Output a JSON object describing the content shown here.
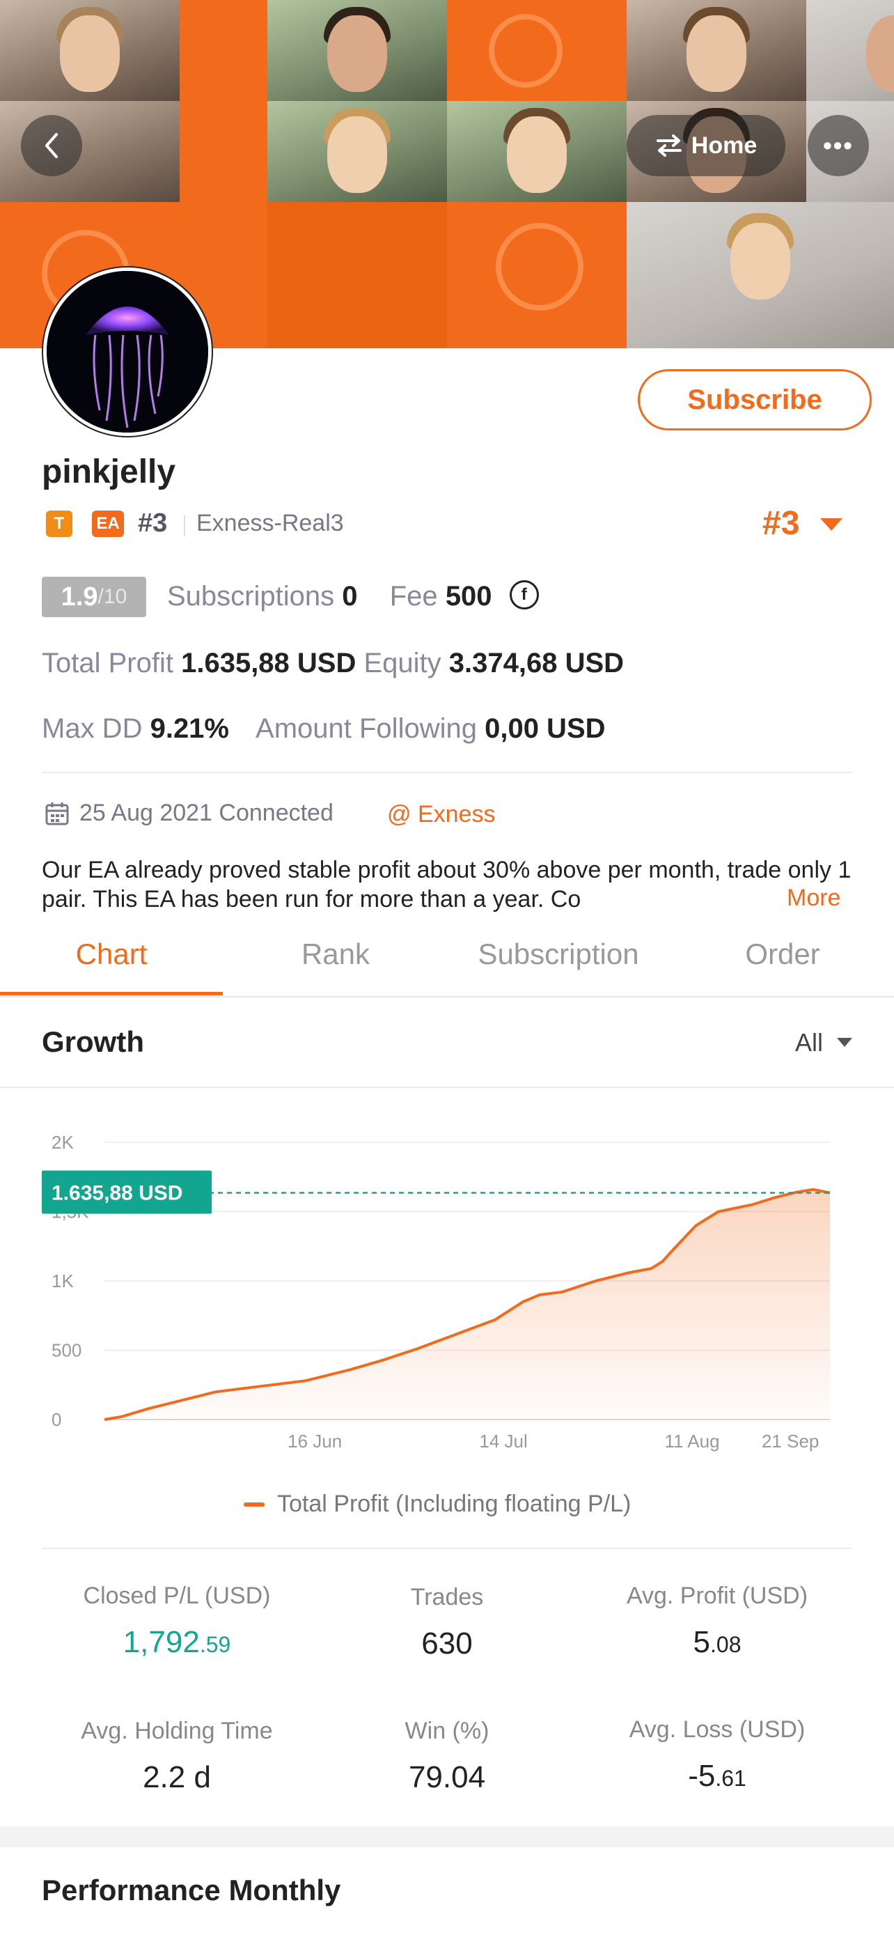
{
  "header": {
    "back_icon": "chevron-left-icon",
    "home_label": "Home",
    "home_icon": "swap-arrows-icon",
    "more_label": "•••"
  },
  "profile": {
    "username": "pinkjelly",
    "badge_t": "T",
    "badge_ea": "EA",
    "rank": "#3",
    "server": "Exness-Real3",
    "rank_big": "#3",
    "subscribe_label": "Subscribe",
    "score": "1.9",
    "score_den": "/10",
    "subscriptions_label": "Subscriptions",
    "subscriptions_value": "0",
    "fee_label": "Fee",
    "fee_value": "500",
    "fee_icon": "f",
    "total_profit_label": "Total Profit",
    "total_profit_value": "1.635,88 USD",
    "equity_label": "Equity",
    "equity_value": "3.374,68 USD",
    "max_dd_label": "Max DD",
    "max_dd_value": "9.21%",
    "amount_following_label": "Amount Following",
    "amount_following_value": "0,00 USD",
    "connected_text": "25 Aug 2021 Connected",
    "broker": "@ Exness",
    "description": "Our EA already proved stable profit about 30% above per month, trade only 1 pair. This EA has been run for more than a year. Co",
    "more_link": "More"
  },
  "tabs": [
    "Chart",
    "Rank",
    "Subscription",
    "Order"
  ],
  "growth": {
    "title": "Growth",
    "range": "All",
    "legend": "Total Profit (Including floating P/L)",
    "current_label": "1.635,88 USD"
  },
  "chart_data": {
    "type": "area",
    "series": [
      {
        "name": "Total Profit (Including floating P/L)",
        "x": [
          0,
          0.03,
          0.08,
          0.14,
          0.2,
          0.28,
          0.36,
          0.44,
          0.5,
          0.56,
          0.62,
          0.7,
          0.75,
          0.78,
          0.82,
          0.88,
          0.94,
          0.98,
          1.0,
          1.02,
          1.06,
          1.1,
          1.16,
          1.2,
          1.24,
          1.27,
          1.3
        ],
        "values": [
          0,
          20,
          80,
          140,
          200,
          240,
          280,
          360,
          430,
          510,
          600,
          720,
          850,
          900,
          920,
          1000,
          1060,
          1090,
          1140,
          1230,
          1400,
          1500,
          1550,
          1600,
          1640,
          1660,
          1635.88
        ]
      }
    ],
    "x_ticks": [
      "16 Jun",
      "14 Jul",
      "11 Aug",
      "21 Sep"
    ],
    "y_ticks": [
      "0",
      "500",
      "1K",
      "1,5K",
      "2K"
    ],
    "ylim": [
      0,
      2000
    ],
    "reference_value": 1635.88,
    "reference_label": "1.635,88 USD",
    "colors": {
      "line": "#f26b1d",
      "reference": "#12a690"
    }
  },
  "stats": [
    {
      "label": "Closed P/L (USD)",
      "int": "1,792",
      "dec": ".59",
      "green": true
    },
    {
      "label": "Trades",
      "int": "630",
      "dec": "",
      "green": false
    },
    {
      "label": "Avg. Profit (USD)",
      "int": "5",
      "dec": ".08",
      "green": false
    },
    {
      "label": "Avg. Holding Time",
      "int": "2.2 d",
      "dec": "",
      "green": false
    },
    {
      "label": "Win (%)",
      "int": "79.04",
      "dec": "",
      "green": false
    },
    {
      "label": "Avg. Loss (USD)",
      "int": "-5",
      "dec": ".61",
      "green": false
    }
  ],
  "performance": {
    "title": "Performance Monthly"
  },
  "colors": {
    "accent": "#f26b1d",
    "positive": "#12a690"
  }
}
